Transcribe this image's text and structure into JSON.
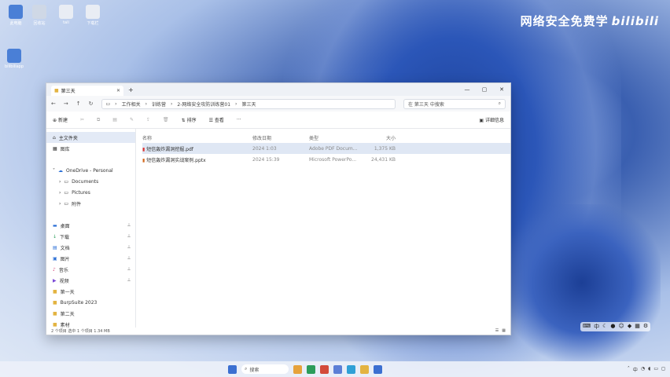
{
  "desktop": {
    "icons": [
      {
        "label": "此电脑",
        "color": "#4a7fd6"
      },
      {
        "label": "回收站",
        "color": "#cfd8e6"
      },
      {
        "label": "tali",
        "color": "#e9edf4"
      },
      {
        "label": "下载栏",
        "color": "#e9edf4"
      },
      {
        "label": "bilibiliapp",
        "color": "#4a7fd6"
      }
    ],
    "watermark": "网络安全免费学",
    "brand": "bilibili"
  },
  "window": {
    "tab_title": "第三天",
    "breadcrumbs": [
      "工作相关",
      "训练营",
      "2-网络安全攻防训练营01",
      "第三天"
    ],
    "search_placeholder": "在 第三天 中搜索",
    "toolbar": {
      "new_label": "新建",
      "sort_label": "排序",
      "view_label": "查看",
      "more_label": "···",
      "details_label": "详细信息"
    },
    "sidebar": {
      "items": [
        {
          "label": "主文件夹",
          "icon": "home-icon"
        },
        {
          "label": "图库",
          "icon": "gallery-icon"
        },
        {
          "label": "OneDrive - Personal",
          "icon": "cloud-icon"
        },
        {
          "label": "Documents",
          "icon": "folder-icon"
        },
        {
          "label": "Pictures",
          "icon": "folder-icon"
        },
        {
          "label": "附件",
          "icon": "folder-icon"
        }
      ],
      "quick": [
        {
          "label": "桌面",
          "icon": "desktop-icon"
        },
        {
          "label": "下载",
          "icon": "download-icon"
        },
        {
          "label": "文档",
          "icon": "document-icon"
        },
        {
          "label": "图片",
          "icon": "picture-icon"
        },
        {
          "label": "音乐",
          "icon": "music-icon"
        },
        {
          "label": "视频",
          "icon": "video-icon"
        },
        {
          "label": "第一天",
          "icon": "folder-icon"
        },
        {
          "label": "BurpSuite 2023",
          "icon": "folder-icon"
        },
        {
          "label": "第二天",
          "icon": "folder-icon"
        },
        {
          "label": "素材",
          "icon": "folder-icon"
        }
      ]
    },
    "columns": [
      "名称",
      "修改日期",
      "类型",
      "大小"
    ],
    "files": [
      {
        "name": "短信轰炸漏洞挖掘.pdf",
        "date": "2024 1:03",
        "type": "Adobe PDF Docum...",
        "size": "1,375 KB",
        "selected": true
      },
      {
        "name": "短信轰炸漏洞实战案例.pptx",
        "date": "2024 15:39",
        "type": "Microsoft PowerPo...",
        "size": "24,431 KB",
        "selected": false
      }
    ],
    "status": "2 个项目  选中 1 个项目 1.34 MB"
  },
  "taskbar": {
    "search_label": "搜索",
    "icons": [
      "#3b6fd1",
      "#e6a23c",
      "#2b9c5a",
      "#d34a3a",
      "#5c7fd6",
      "#2fa0d6",
      "#3b6fd1"
    ]
  }
}
